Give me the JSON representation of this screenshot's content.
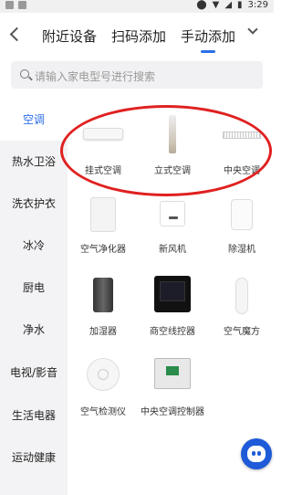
{
  "status_bar": {
    "time": "3:29"
  },
  "header": {
    "tabs": [
      {
        "label": "附近设备"
      },
      {
        "label": "扫码添加"
      },
      {
        "label": "手动添加"
      }
    ]
  },
  "search": {
    "placeholder": "请输入家电型号进行搜索"
  },
  "sidebar": {
    "items": [
      {
        "label": "空调"
      },
      {
        "label": "热水卫浴"
      },
      {
        "label": "洗衣护衣"
      },
      {
        "label": "冰冷"
      },
      {
        "label": "厨电"
      },
      {
        "label": "净水"
      },
      {
        "label": "电视/影音"
      },
      {
        "label": "生活电器"
      },
      {
        "label": "运动健康"
      }
    ]
  },
  "devices": [
    {
      "label": "挂式空调"
    },
    {
      "label": "立式空调"
    },
    {
      "label": "中央空调"
    },
    {
      "label": "空气净化器"
    },
    {
      "label": "新风机"
    },
    {
      "label": "除湿机"
    },
    {
      "label": "加湿器"
    },
    {
      "label": "商空线控器"
    },
    {
      "label": "空气魔方"
    },
    {
      "label": "空气检测仪"
    },
    {
      "label": "中央空调控制器"
    }
  ],
  "colors": {
    "accent": "#2b6fe8",
    "annotation": "#e02020"
  }
}
